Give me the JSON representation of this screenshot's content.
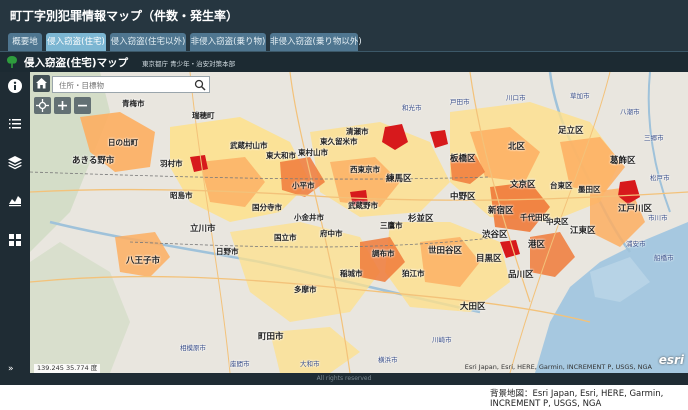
{
  "app": {
    "title": "町丁字別犯罪情報マップ（件数・発生率）",
    "tabs": [
      "概要地",
      "侵入窃盗(住宅)",
      "侵入窃盗(住宅以外)",
      "非侵入窃盗(乗り物)",
      "非侵入窃盗(乗り物以外)"
    ],
    "active_tab": 1
  },
  "map": {
    "name": "侵入窃盗(住宅)マップ",
    "credit": "東京都庁 青少年・治安対策本部",
    "search_placeholder": "住所・目標物",
    "scale": "139.245 35.774 度",
    "basemap_attribution": "Esri Japan, Esri, HERE, Garmin, INCREMENT P, USGS, NGA",
    "esri_logo": "esri",
    "rights": "All rights reserved"
  },
  "side_icons": [
    "info-icon",
    "list-icon",
    "layers-icon",
    "chart-icon",
    "grid-icon",
    "expand-icon"
  ],
  "places": [
    "青梅市",
    "日の出町",
    "あきる野市",
    "八王子市",
    "瑞穂町",
    "武蔵村山市",
    "東大和市",
    "清瀬市",
    "東村山市",
    "小平市",
    "西東京市",
    "練馬区",
    "板橋区",
    "北区",
    "足立区",
    "葛飾区",
    "立川市",
    "国分寺市",
    "小金井市",
    "武蔵野市",
    "杉並区",
    "中野区",
    "新宿区",
    "文京区",
    "台東区",
    "墨田区",
    "江戸川区",
    "江東区",
    "中央区",
    "千代田区",
    "港区",
    "渋谷区",
    "世田谷区",
    "目黒区",
    "品川区",
    "大田区",
    "多摩市",
    "稲城市",
    "町田市",
    "調布市",
    "狛江市",
    "日野市",
    "府中市",
    "三鷹市",
    "昭島市",
    "羽村市",
    "国立市",
    "東久留米市",
    "和光市",
    "戸田市",
    "川口市",
    "草加市",
    "八潮市",
    "三郷市",
    "松戸市",
    "市川市",
    "浦安市",
    "船橋市",
    "川崎市",
    "横浜市",
    "相模原市",
    "大和市",
    "座間市"
  ],
  "caption": "背景地図：Esri Japan, Esri, HERE, Garmin, INCREMENT P, USGS, NGA",
  "colors": {
    "high": "#d7191c",
    "mid_high": "#f07a3a",
    "mid": "#fdae61",
    "low": "#fee08b",
    "water": "#a6c8e0",
    "land": "#e9e6df"
  }
}
